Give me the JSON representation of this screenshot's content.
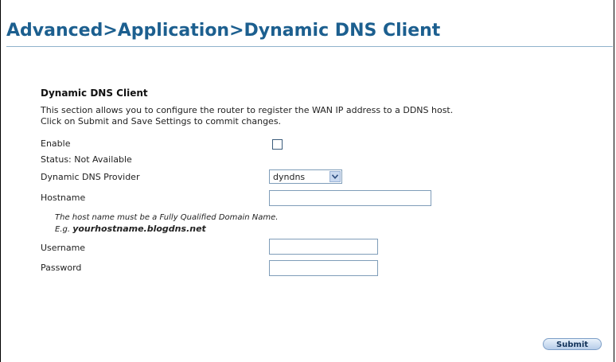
{
  "page": {
    "title": "Advanced>Application>Dynamic DNS Client"
  },
  "section": {
    "heading": "Dynamic DNS Client",
    "desc_line1": "This section allows you to configure the router to register the WAN IP address to a DDNS host.",
    "desc_line2": "Click on Submit and Save Settings to commit changes."
  },
  "form": {
    "enable_label": "Enable",
    "enable_checked": false,
    "status_text": "Status: Not Available",
    "provider_label": "Dynamic DNS Provider",
    "provider_value": "dyndns",
    "hostname_label": "Hostname",
    "hostname_value": "",
    "hint_line1": "The host name must be a Fully Qualified Domain Name.",
    "hint_prefix": "E.g. ",
    "hint_example": "yourhostname.blogdns.net",
    "username_label": "Username",
    "username_value": "",
    "password_label": "Password",
    "password_value": ""
  },
  "actions": {
    "submit_label": "Submit"
  },
  "colors": {
    "title": "#1c5f8f",
    "rule": "#8fb3cc",
    "button_border": "#7d9fc7"
  },
  "icons": {
    "dropdown": "chevron-down-icon"
  }
}
